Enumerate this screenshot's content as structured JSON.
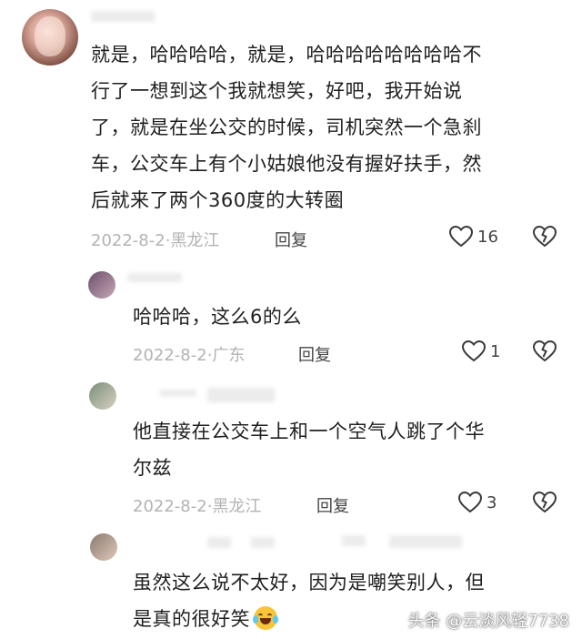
{
  "comments": [
    {
      "text_lines": [
        "就是，哈哈哈哈，就是，哈哈哈哈哈哈哈哈不",
        "行了一想到这个我就想笑，好吧，我开始说",
        "了，就是在坐公交的时候，司机突然一个急刹",
        "车，公交车上有个小姑娘他没有握好扶手，然",
        "后就来了两个360度的大转圈"
      ],
      "date": "2022-8-2",
      "location": "黑龙江",
      "reply_label": "回复",
      "likes": "16"
    },
    {
      "text_lines": [
        "哈哈哈，这么6的么"
      ],
      "date": "2022-8-2",
      "location": "广东",
      "reply_label": "回复",
      "likes": "1"
    },
    {
      "text_lines": [
        "他直接在公交车上和一个空气人跳了个华",
        "尔兹"
      ],
      "date": "2022-8-2",
      "location": "黑龙江",
      "reply_label": "回复",
      "likes": "3"
    },
    {
      "text_lines": [
        "虽然这么说不太好，因为是嘲笑别人，但",
        "是真的很好笑"
      ],
      "emoji": "loudly-crying-laughing"
    }
  ],
  "watermark": "头条 @云淡风轻7738",
  "icons": {
    "like": "heart-outline-icon",
    "dislike": "broken-heart-icon"
  }
}
